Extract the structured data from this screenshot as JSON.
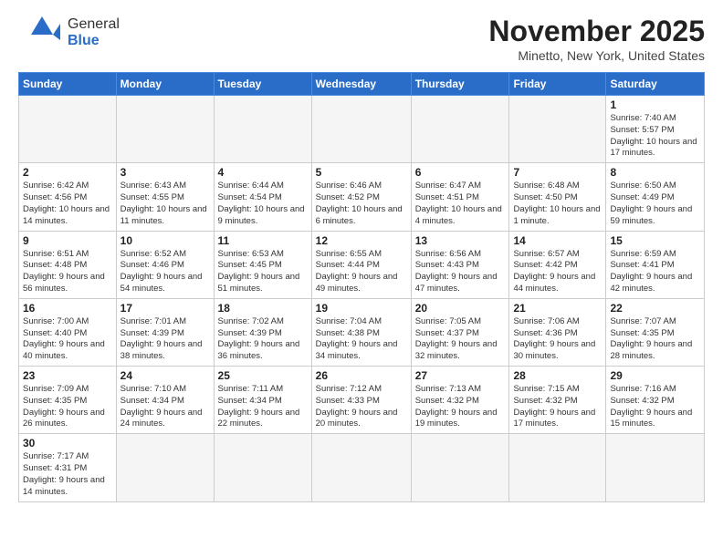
{
  "header": {
    "logo_general": "General",
    "logo_blue": "Blue",
    "month_title": "November 2025",
    "subtitle": "Minetto, New York, United States"
  },
  "weekdays": [
    "Sunday",
    "Monday",
    "Tuesday",
    "Wednesday",
    "Thursday",
    "Friday",
    "Saturday"
  ],
  "weeks": [
    [
      {
        "day": "",
        "info": ""
      },
      {
        "day": "",
        "info": ""
      },
      {
        "day": "",
        "info": ""
      },
      {
        "day": "",
        "info": ""
      },
      {
        "day": "",
        "info": ""
      },
      {
        "day": "",
        "info": ""
      },
      {
        "day": "1",
        "info": "Sunrise: 7:40 AM\nSunset: 5:57 PM\nDaylight: 10 hours and 17 minutes."
      }
    ],
    [
      {
        "day": "2",
        "info": "Sunrise: 6:42 AM\nSunset: 4:56 PM\nDaylight: 10 hours and 14 minutes."
      },
      {
        "day": "3",
        "info": "Sunrise: 6:43 AM\nSunset: 4:55 PM\nDaylight: 10 hours and 11 minutes."
      },
      {
        "day": "4",
        "info": "Sunrise: 6:44 AM\nSunset: 4:54 PM\nDaylight: 10 hours and 9 minutes."
      },
      {
        "day": "5",
        "info": "Sunrise: 6:46 AM\nSunset: 4:52 PM\nDaylight: 10 hours and 6 minutes."
      },
      {
        "day": "6",
        "info": "Sunrise: 6:47 AM\nSunset: 4:51 PM\nDaylight: 10 hours and 4 minutes."
      },
      {
        "day": "7",
        "info": "Sunrise: 6:48 AM\nSunset: 4:50 PM\nDaylight: 10 hours and 1 minute."
      },
      {
        "day": "8",
        "info": "Sunrise: 6:50 AM\nSunset: 4:49 PM\nDaylight: 9 hours and 59 minutes."
      }
    ],
    [
      {
        "day": "9",
        "info": "Sunrise: 6:51 AM\nSunset: 4:48 PM\nDaylight: 9 hours and 56 minutes."
      },
      {
        "day": "10",
        "info": "Sunrise: 6:52 AM\nSunset: 4:46 PM\nDaylight: 9 hours and 54 minutes."
      },
      {
        "day": "11",
        "info": "Sunrise: 6:53 AM\nSunset: 4:45 PM\nDaylight: 9 hours and 51 minutes."
      },
      {
        "day": "12",
        "info": "Sunrise: 6:55 AM\nSunset: 4:44 PM\nDaylight: 9 hours and 49 minutes."
      },
      {
        "day": "13",
        "info": "Sunrise: 6:56 AM\nSunset: 4:43 PM\nDaylight: 9 hours and 47 minutes."
      },
      {
        "day": "14",
        "info": "Sunrise: 6:57 AM\nSunset: 4:42 PM\nDaylight: 9 hours and 44 minutes."
      },
      {
        "day": "15",
        "info": "Sunrise: 6:59 AM\nSunset: 4:41 PM\nDaylight: 9 hours and 42 minutes."
      }
    ],
    [
      {
        "day": "16",
        "info": "Sunrise: 7:00 AM\nSunset: 4:40 PM\nDaylight: 9 hours and 40 minutes."
      },
      {
        "day": "17",
        "info": "Sunrise: 7:01 AM\nSunset: 4:39 PM\nDaylight: 9 hours and 38 minutes."
      },
      {
        "day": "18",
        "info": "Sunrise: 7:02 AM\nSunset: 4:39 PM\nDaylight: 9 hours and 36 minutes."
      },
      {
        "day": "19",
        "info": "Sunrise: 7:04 AM\nSunset: 4:38 PM\nDaylight: 9 hours and 34 minutes."
      },
      {
        "day": "20",
        "info": "Sunrise: 7:05 AM\nSunset: 4:37 PM\nDaylight: 9 hours and 32 minutes."
      },
      {
        "day": "21",
        "info": "Sunrise: 7:06 AM\nSunset: 4:36 PM\nDaylight: 9 hours and 30 minutes."
      },
      {
        "day": "22",
        "info": "Sunrise: 7:07 AM\nSunset: 4:35 PM\nDaylight: 9 hours and 28 minutes."
      }
    ],
    [
      {
        "day": "23",
        "info": "Sunrise: 7:09 AM\nSunset: 4:35 PM\nDaylight: 9 hours and 26 minutes."
      },
      {
        "day": "24",
        "info": "Sunrise: 7:10 AM\nSunset: 4:34 PM\nDaylight: 9 hours and 24 minutes."
      },
      {
        "day": "25",
        "info": "Sunrise: 7:11 AM\nSunset: 4:34 PM\nDaylight: 9 hours and 22 minutes."
      },
      {
        "day": "26",
        "info": "Sunrise: 7:12 AM\nSunset: 4:33 PM\nDaylight: 9 hours and 20 minutes."
      },
      {
        "day": "27",
        "info": "Sunrise: 7:13 AM\nSunset: 4:32 PM\nDaylight: 9 hours and 19 minutes."
      },
      {
        "day": "28",
        "info": "Sunrise: 7:15 AM\nSunset: 4:32 PM\nDaylight: 9 hours and 17 minutes."
      },
      {
        "day": "29",
        "info": "Sunrise: 7:16 AM\nSunset: 4:32 PM\nDaylight: 9 hours and 15 minutes."
      }
    ],
    [
      {
        "day": "30",
        "info": "Sunrise: 7:17 AM\nSunset: 4:31 PM\nDaylight: 9 hours and 14 minutes."
      },
      {
        "day": "",
        "info": ""
      },
      {
        "day": "",
        "info": ""
      },
      {
        "day": "",
        "info": ""
      },
      {
        "day": "",
        "info": ""
      },
      {
        "day": "",
        "info": ""
      },
      {
        "day": "",
        "info": ""
      }
    ]
  ]
}
